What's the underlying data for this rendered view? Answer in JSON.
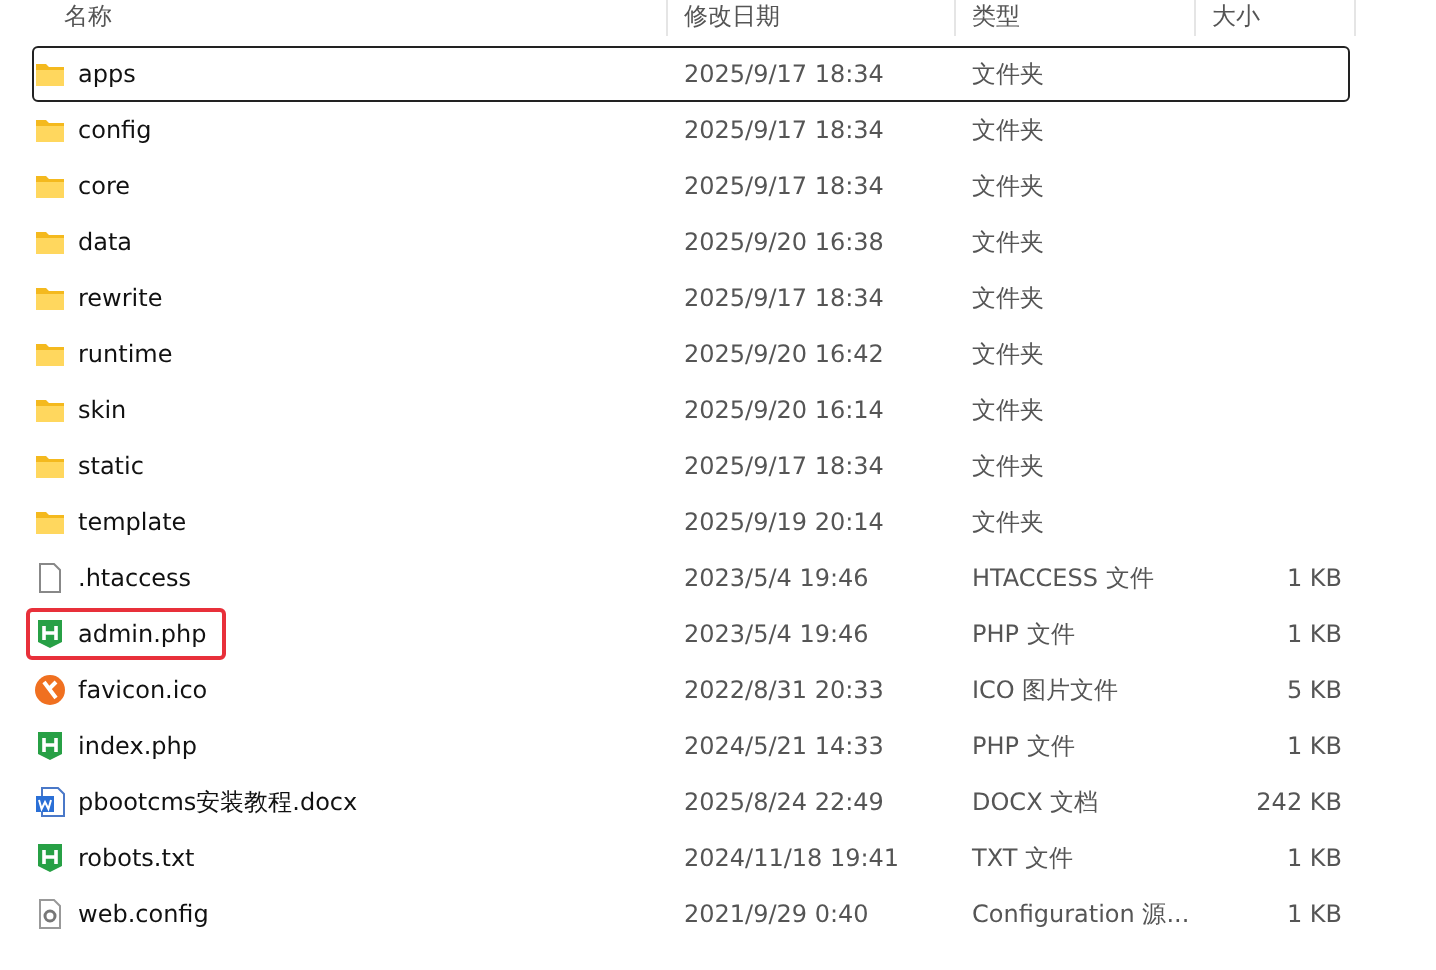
{
  "columns": [
    "名称",
    "修改日期",
    "类型",
    "大小"
  ],
  "rows": [
    {
      "kind": "folder",
      "name": "apps",
      "date": "2025/9/17 18:34",
      "type": "文件夹",
      "focused": true,
      "highlighted": false
    },
    {
      "kind": "folder",
      "name": "config",
      "date": "2025/9/17 18:34",
      "type": "文件夹",
      "focused": false,
      "highlighted": false
    },
    {
      "kind": "folder",
      "name": "core",
      "date": "2025/9/17 18:34",
      "type": "文件夹",
      "focused": false,
      "highlighted": false
    },
    {
      "kind": "folder",
      "name": "data",
      "date": "2025/9/20 16:38",
      "type": "文件夹",
      "focused": false,
      "highlighted": false
    },
    {
      "kind": "folder",
      "name": "rewrite",
      "date": "2025/9/17 18:34",
      "type": "文件夹",
      "focused": false,
      "highlighted": false
    },
    {
      "kind": "folder",
      "name": "runtime",
      "date": "2025/9/20 16:42",
      "type": "文件夹",
      "focused": false,
      "highlighted": false
    },
    {
      "kind": "folder",
      "name": "skin",
      "date": "2025/9/20 16:14",
      "type": "文件夹",
      "focused": false,
      "highlighted": false
    },
    {
      "kind": "folder",
      "name": "static",
      "date": "2025/9/17 18:34",
      "type": "文件夹",
      "focused": false,
      "highlighted": false
    },
    {
      "kind": "folder",
      "name": "template",
      "date": "2025/9/19 20:14",
      "type": "文件夹",
      "focused": false,
      "highlighted": false
    },
    {
      "kind": "file",
      "name": ".htaccess",
      "date": "2023/5/4 19:46",
      "type": "HTACCESS 文件",
      "size": "1 KB",
      "focused": false,
      "highlighted": false
    },
    {
      "kind": "php",
      "name": "admin.php",
      "date": "2023/5/4 19:46",
      "type": "PHP 文件",
      "size": "1 KB",
      "focused": false,
      "highlighted": true
    },
    {
      "kind": "ico",
      "name": "favicon.ico",
      "date": "2022/8/31 20:33",
      "type": "ICO 图片文件",
      "size": "5 KB",
      "focused": false,
      "highlighted": false
    },
    {
      "kind": "php",
      "name": "index.php",
      "date": "2024/5/21 14:33",
      "type": "PHP 文件",
      "size": "1 KB",
      "focused": false,
      "highlighted": false
    },
    {
      "kind": "docx",
      "name": "pbootcms安装教程.docx",
      "date": "2025/8/24 22:49",
      "type": "DOCX 文档",
      "size": "242 KB",
      "focused": false,
      "highlighted": false
    },
    {
      "kind": "php",
      "name": "robots.txt",
      "date": "2024/11/18 19:41",
      "type": "TXT 文件",
      "size": "1 KB",
      "focused": false,
      "highlighted": false
    },
    {
      "kind": "config",
      "name": "web.config",
      "date": "2021/9/29 0:40",
      "type": "Configuration 源...",
      "size": "1 KB",
      "focused": false,
      "highlighted": false
    }
  ]
}
